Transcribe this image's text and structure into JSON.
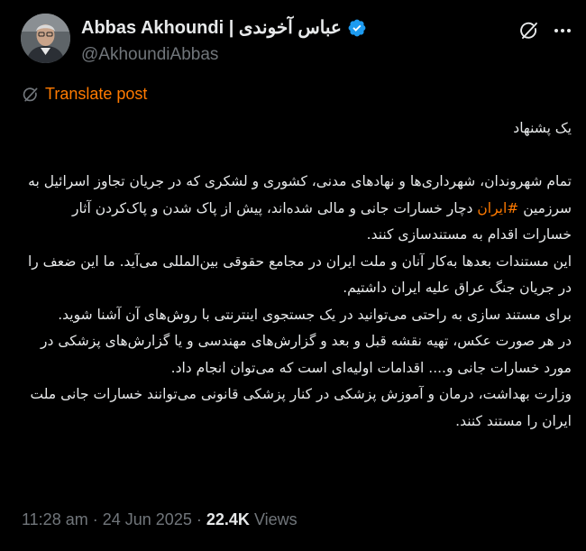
{
  "author": {
    "display_name": "Abbas Akhoundi | عباس آخوندی",
    "handle": "@AkhoundiAbbas",
    "verified": true
  },
  "translate_label": "Translate post",
  "post": {
    "title": "یک پشنهاد",
    "p1_before": "تمام شهروندان، شهرداری‌ها و نهادهای مدنی، کشوری و لشکری که در جریان تجاوز اسرائیل به سرزمین",
    "hashtag": "#ایران",
    "p1_after": "دچار خسارات جانی و مالی شده‌اند، پیش از پاک شدن و پاک‌کردن آثار خسارات اقدام به مستندسازی کنند.",
    "p2": "این مستندات بعدها به‌کار آنان و ملت ایران در مجامع حقوقی بین‌المللی می‌آید. ما این ضعف را در جریان جنگ عراق علیه ایران داشتیم.",
    "p3": "برای مستند سازی به راحتی می‌توانید در یک جستجوی اینترنتی با روش‌های آن آشنا شوید.",
    "p4": "در هر صورت عکس، تهیه نقشه قبل و بعد و گزارش‌های مهندسی و یا گزارش‌های پزشکی در مورد خسارات جانی و.... اقدامات اولیه‌ای است که می‌توان انجام داد.",
    "p5": "وزارت بهداشت، درمان و آموزش پزشکی در کنار پزشکی قانونی می‌توانند خسارات جانی ملت ایران را مستند کنند."
  },
  "meta": {
    "time": "11:28 am",
    "date": "24 Jun 2025",
    "separator": "·",
    "views_count": "22.4K",
    "views_label": "Views"
  },
  "icons": {
    "verified": "verified-badge-icon",
    "grok": "grok-icon",
    "more": "more-options-icon",
    "translate": "translate-icon"
  },
  "colors": {
    "background": "#000000",
    "text": "#e7e9ea",
    "secondary": "#71767b",
    "accent": "#ff7a00",
    "verified": "#1d9bf0"
  }
}
